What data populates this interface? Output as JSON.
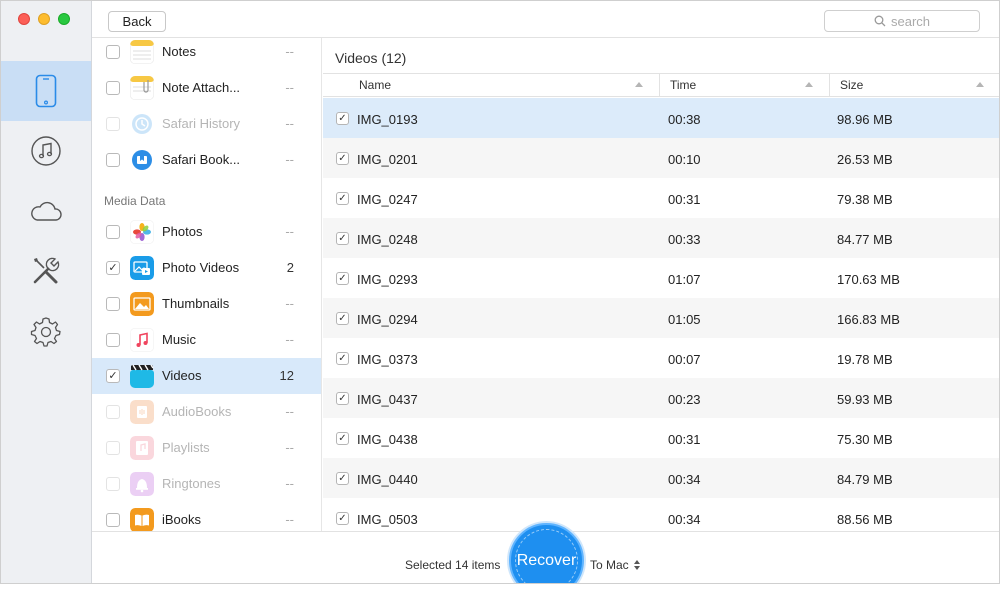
{
  "toolbar": {
    "back_label": "Back",
    "search_placeholder": "search"
  },
  "rail": {
    "items": [
      {
        "icon": "phone-icon",
        "active": true
      },
      {
        "icon": "music-note-icon",
        "active": false
      },
      {
        "icon": "cloud-icon",
        "active": false
      },
      {
        "icon": "tools-icon",
        "active": false
      },
      {
        "icon": "gear-icon",
        "active": false
      }
    ]
  },
  "categories": {
    "section_media": "Media Data",
    "items": [
      {
        "label": "Notes",
        "count": "--",
        "checked": false,
        "disabled": false,
        "icon": "notes-icon"
      },
      {
        "label": "Note Attach...",
        "count": "--",
        "checked": false,
        "disabled": false,
        "icon": "note-attachment-icon"
      },
      {
        "label": "Safari History",
        "count": "--",
        "checked": false,
        "disabled": true,
        "icon": "safari-history-icon"
      },
      {
        "label": "Safari Book...",
        "count": "--",
        "checked": false,
        "disabled": false,
        "icon": "safari-bookmark-icon"
      },
      {
        "label": "Photos",
        "count": "--",
        "checked": false,
        "disabled": false,
        "icon": "photos-icon"
      },
      {
        "label": "Photo Videos",
        "count": "2",
        "checked": true,
        "disabled": false,
        "icon": "photo-videos-icon"
      },
      {
        "label": "Thumbnails",
        "count": "--",
        "checked": false,
        "disabled": false,
        "icon": "thumbnails-icon"
      },
      {
        "label": "Music",
        "count": "--",
        "checked": false,
        "disabled": false,
        "icon": "music-icon"
      },
      {
        "label": "Videos",
        "count": "12",
        "checked": true,
        "disabled": false,
        "selected": true,
        "icon": "videos-icon"
      },
      {
        "label": "AudioBooks",
        "count": "--",
        "checked": false,
        "disabled": true,
        "icon": "audiobooks-icon"
      },
      {
        "label": "Playlists",
        "count": "--",
        "checked": false,
        "disabled": true,
        "icon": "playlists-icon"
      },
      {
        "label": "Ringtones",
        "count": "--",
        "checked": false,
        "disabled": true,
        "icon": "ringtones-icon"
      },
      {
        "label": "iBooks",
        "count": "--",
        "checked": false,
        "disabled": false,
        "icon": "ibooks-icon"
      }
    ]
  },
  "files": {
    "title": "Videos (12)",
    "columns": {
      "name": "Name",
      "time": "Time",
      "size": "Size"
    },
    "rows": [
      {
        "name": "IMG_0193",
        "time": "00:38",
        "size": "98.96 MB",
        "checked": true
      },
      {
        "name": "IMG_0201",
        "time": "00:10",
        "size": "26.53 MB",
        "checked": true
      },
      {
        "name": "IMG_0247",
        "time": "00:31",
        "size": "79.38 MB",
        "checked": true
      },
      {
        "name": "IMG_0248",
        "time": "00:33",
        "size": "84.77 MB",
        "checked": true
      },
      {
        "name": "IMG_0293",
        "time": "01:07",
        "size": "170.63 MB",
        "checked": true
      },
      {
        "name": "IMG_0294",
        "time": "01:05",
        "size": "166.83 MB",
        "checked": true
      },
      {
        "name": "IMG_0373",
        "time": "00:07",
        "size": "19.78 MB",
        "checked": true
      },
      {
        "name": "IMG_0437",
        "time": "00:23",
        "size": "59.93 MB",
        "checked": true
      },
      {
        "name": "IMG_0438",
        "time": "00:31",
        "size": "75.30 MB",
        "checked": true
      },
      {
        "name": "IMG_0440",
        "time": "00:34",
        "size": "84.79 MB",
        "checked": true
      },
      {
        "name": "IMG_0503",
        "time": "00:34",
        "size": "88.56 MB",
        "checked": true
      }
    ]
  },
  "footer": {
    "selected_text": "Selected 14 items",
    "recover_label": "Recover",
    "destination": "To Mac"
  },
  "colors": {
    "accent": "#1e8ff0",
    "selection": "#d8e9fa",
    "rail_active": "#c9def5"
  }
}
